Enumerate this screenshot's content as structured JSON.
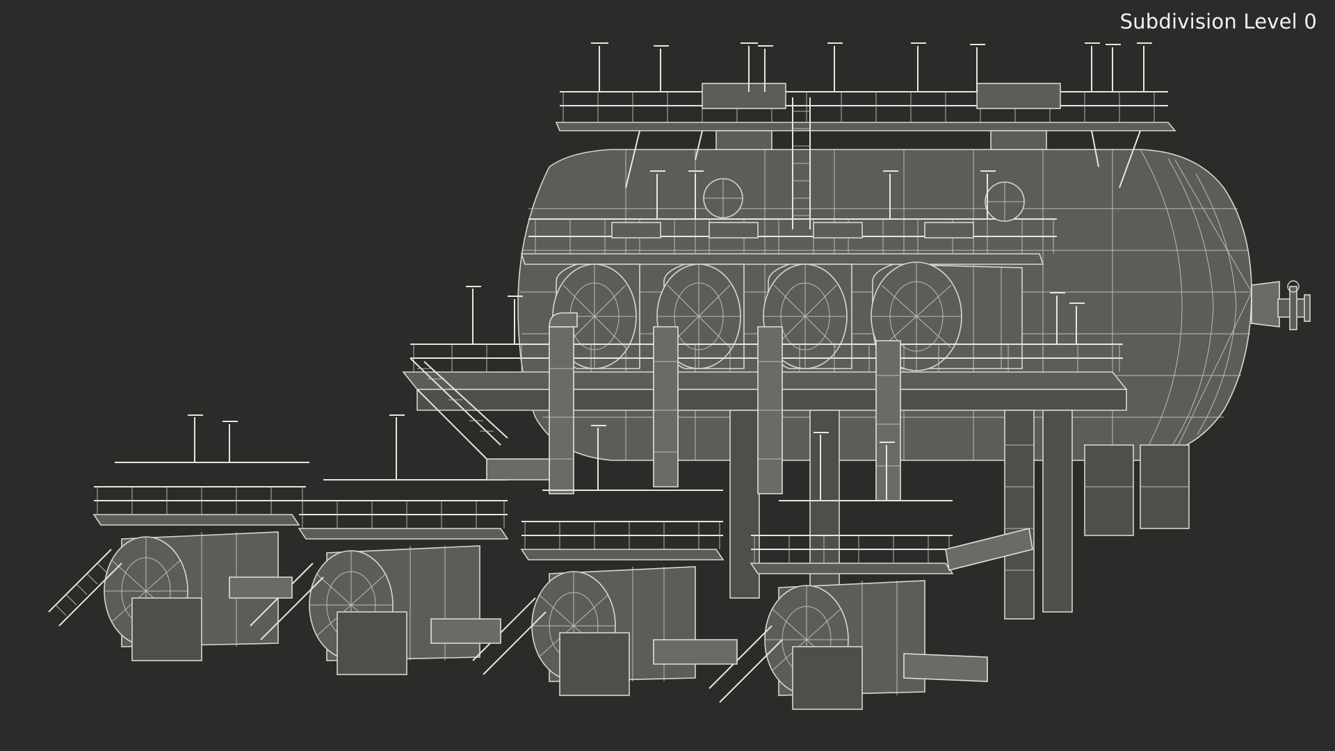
{
  "overlay": {
    "subdivision_label": "Subdivision Level 0"
  },
  "colors": {
    "background": "#2b2b2a",
    "wire": "#d9d8ce",
    "surface": "#5c5d58",
    "label_text": "#f2f2f2"
  }
}
